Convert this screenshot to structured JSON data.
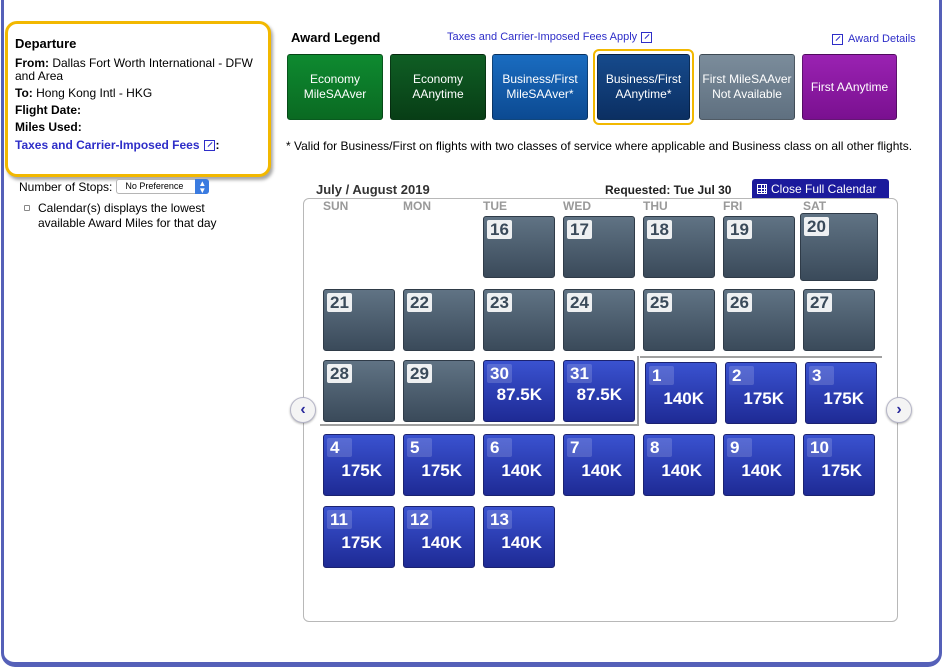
{
  "departure": {
    "title": "Departure",
    "from_label": "From:",
    "from_value": "Dallas Fort Worth International - DFW and Area",
    "to_label": "To:",
    "to_value": "Hong Kong Intl - HKG",
    "flight_date_label": "Flight Date:",
    "miles_used_label": "Miles Used:",
    "taxes_link": "Taxes and Carrier-Imposed Fees",
    "taxes_suffix": ":"
  },
  "stops": {
    "label": "Number of Stops:",
    "selected": "No Preference"
  },
  "calendar_note": "Calendar(s) displays the lowest available Award Miles for that day",
  "legend": {
    "title": "Award Legend",
    "taxes_link": "Taxes and Carrier-Imposed Fees Apply",
    "award_details": "Award Details",
    "items": [
      {
        "label": "Economy MileSAAver",
        "color": "#0c7a2a"
      },
      {
        "label": "Economy AAnytime",
        "color": "#0b4f1d"
      },
      {
        "label": "Business/First MileSAAver*",
        "color": "#0f5aa8"
      },
      {
        "label": "Business/First AAnytime*",
        "color": "#0d3b78"
      },
      {
        "label": "First MileSAAver Not Available",
        "color": "#6f7f8e"
      },
      {
        "label": "First AAnytime",
        "color": "#8a1aa0"
      }
    ]
  },
  "footnote": "* Valid for Business/First on flights with two classes of service where applicable and Business class on all other flights.",
  "calendar": {
    "month_title": "July / August 2019",
    "requested": "Requested: Tue Jul 30",
    "close_label": "Close Full Calendar",
    "days_of_week": [
      "SUN",
      "MON",
      "TUE",
      "WED",
      "THU",
      "FRI",
      "SAT"
    ],
    "days": [
      {
        "day": "16",
        "miles": ""
      },
      {
        "day": "17",
        "miles": ""
      },
      {
        "day": "18",
        "miles": ""
      },
      {
        "day": "19",
        "miles": ""
      },
      {
        "day": "20",
        "miles": ""
      },
      {
        "day": "21",
        "miles": ""
      },
      {
        "day": "22",
        "miles": ""
      },
      {
        "day": "23",
        "miles": ""
      },
      {
        "day": "24",
        "miles": ""
      },
      {
        "day": "25",
        "miles": ""
      },
      {
        "day": "26",
        "miles": ""
      },
      {
        "day": "27",
        "miles": ""
      },
      {
        "day": "28",
        "miles": ""
      },
      {
        "day": "29",
        "miles": ""
      },
      {
        "day": "30",
        "miles": "87.5K"
      },
      {
        "day": "31",
        "miles": "87.5K"
      },
      {
        "day": "1",
        "miles": "140K"
      },
      {
        "day": "2",
        "miles": "175K"
      },
      {
        "day": "3",
        "miles": "175K"
      },
      {
        "day": "4",
        "miles": "175K"
      },
      {
        "day": "5",
        "miles": "175K"
      },
      {
        "day": "6",
        "miles": "140K"
      },
      {
        "day": "7",
        "miles": "140K"
      },
      {
        "day": "8",
        "miles": "140K"
      },
      {
        "day": "9",
        "miles": "140K"
      },
      {
        "day": "10",
        "miles": "175K"
      },
      {
        "day": "11",
        "miles": "175K"
      },
      {
        "day": "12",
        "miles": "140K"
      },
      {
        "day": "13",
        "miles": "140K"
      }
    ]
  }
}
